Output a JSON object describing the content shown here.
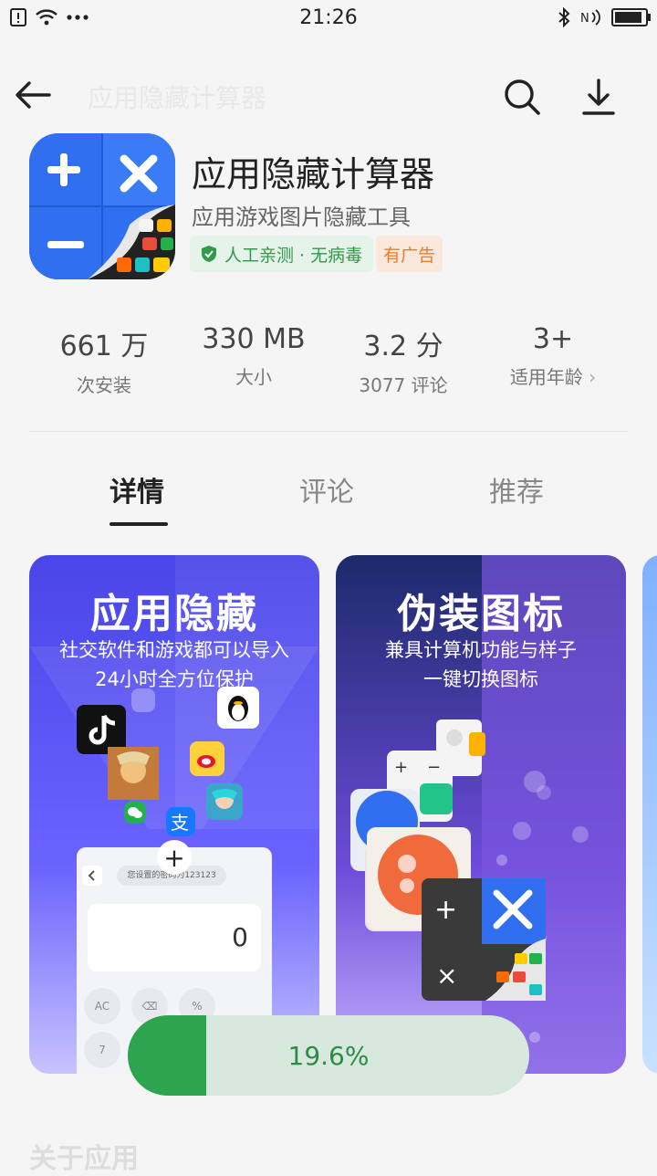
{
  "status_bar": {
    "time": "21:26",
    "icons_left": [
      "alert-icon",
      "wifi-icon",
      "more-dots-icon"
    ],
    "icons_right": [
      "bluetooth-icon",
      "nfc-icon",
      "battery-icon"
    ]
  },
  "top_bar": {
    "faded_title": "应用隐藏计算器"
  },
  "app": {
    "name": "应用隐藏计算器",
    "subtitle": "应用游戏图片隐藏工具",
    "safe_badge": "人工亲测 · 无病毒",
    "ad_badge": "有广告"
  },
  "stats": [
    {
      "value": "661 万",
      "label": "次安装"
    },
    {
      "value": "330 MB",
      "label": "大小"
    },
    {
      "value": "3.2 分",
      "label": "3077 评论"
    },
    {
      "value": "3+",
      "label": "适用年龄"
    }
  ],
  "tabs": [
    {
      "label": "详情",
      "active": true
    },
    {
      "label": "评论",
      "active": false
    },
    {
      "label": "推荐",
      "active": false
    }
  ],
  "screenshots": [
    {
      "title": "应用隐藏",
      "lines": [
        "社交软件和游戏都可以导入",
        "24小时全方位保护"
      ],
      "calc_hint": "您设置的密码为123123",
      "calc_display": "0",
      "keys": [
        "AC",
        "⌫",
        "%",
        "7"
      ]
    },
    {
      "title": "伪装图标",
      "lines": [
        "兼具计算机功能与样子",
        "一键切换图标"
      ]
    }
  ],
  "progress": {
    "value": 0.196,
    "label": "19.6%",
    "fill_color": "#2da44e",
    "track_color": "#d7e9dc"
  },
  "section": {
    "faded_heading": "关于应用"
  }
}
